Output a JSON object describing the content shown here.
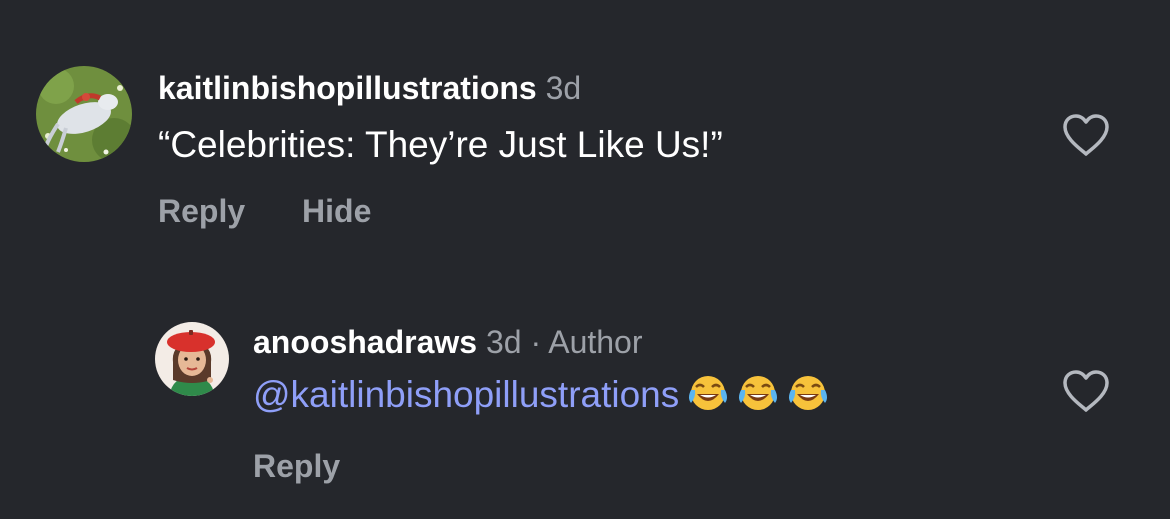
{
  "comments": [
    {
      "username": "kaitlinbishopillustrations",
      "time": "3d",
      "text": "“Celebrities: They’re Just Like Us!”",
      "actions": {
        "reply": "Reply",
        "hide": "Hide"
      },
      "avatar_icon": "horse-illustration-avatar",
      "liked": false
    },
    {
      "username": "anooshadraws",
      "time": "3d",
      "separator": "·",
      "badge": "Author",
      "mention": "@kaitlinbishopillustrations",
      "emojis": [
        "face-with-tears-of-joy",
        "face-with-tears-of-joy",
        "face-with-tears-of-joy"
      ],
      "actions": {
        "reply": "Reply"
      },
      "avatar_icon": "red-beret-portrait-avatar",
      "liked": false
    }
  ],
  "colors": {
    "background": "#25272c",
    "primary_text": "#ffffff",
    "secondary_text": "#9da1a8",
    "mention": "#8f9ff8"
  }
}
